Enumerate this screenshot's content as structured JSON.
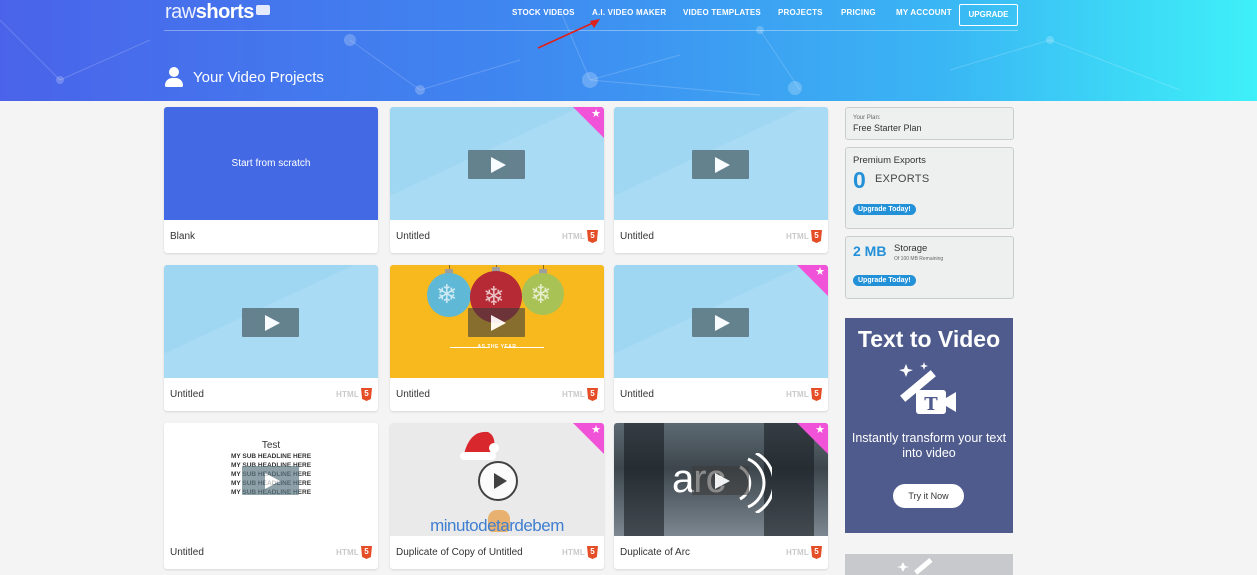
{
  "logo": {
    "part1": "raw",
    "part2": "shorts"
  },
  "nav": {
    "items": [
      "STOCK VIDEOS",
      "A.I. VIDEO MAKER",
      "VIDEO TEMPLATES",
      "PROJECTS",
      "PRICING",
      "MY ACCOUNT"
    ],
    "upgrade": "UPGRADE"
  },
  "page": {
    "title": "Your Video Projects"
  },
  "projects": [
    {
      "name": "Blank",
      "thumb_text": "Start from scratch"
    },
    {
      "name": "Untitled",
      "badge": "HTML"
    },
    {
      "name": "Untitled",
      "badge": "HTML"
    },
    {
      "name": "Untitled",
      "badge": "HTML"
    },
    {
      "name": "Untitled",
      "badge": "HTML",
      "thumb_text": "AS THE YEAR"
    },
    {
      "name": "Untitled",
      "badge": "HTML"
    },
    {
      "name": "Untitled",
      "badge": "HTML",
      "thumb_title": "Test",
      "thumb_lines": [
        "MY SUB HEADLINE HERE",
        "MY SUB HEADLINE HERE",
        "MY SUB HEADLINE HERE",
        "MY SUB HEADLINE HERE",
        "MY SUB HEADLINE HERE"
      ]
    },
    {
      "name": "Duplicate of Copy of Untitled",
      "badge": "HTML",
      "thumb_text": "minutodetardebem"
    },
    {
      "name": "Duplicate of Arc",
      "badge": "HTML",
      "thumb_text": "arc"
    }
  ],
  "html5_glyph": "5",
  "star_glyph": "★",
  "sidebar": {
    "plan": {
      "small": "Your Plan:",
      "name": "Free Starter Plan"
    },
    "exports": {
      "title": "Premium Exports",
      "count": "0",
      "label": "EXPORTS",
      "cta": "Upgrade Today!"
    },
    "storage": {
      "amount": "2 MB",
      "label": "Storage",
      "sub": "Of 100 MB Remaining",
      "cta": "Upgrade Today!"
    },
    "promo": {
      "title": "Text to Video",
      "text": "Instantly transform your text into video",
      "button": "Try it Now"
    }
  },
  "colors": {
    "accent": "#2391d8",
    "promo_bg": "#4e5b8c",
    "premium_corner": "#f052d8",
    "blank_card": "#4469e4"
  }
}
